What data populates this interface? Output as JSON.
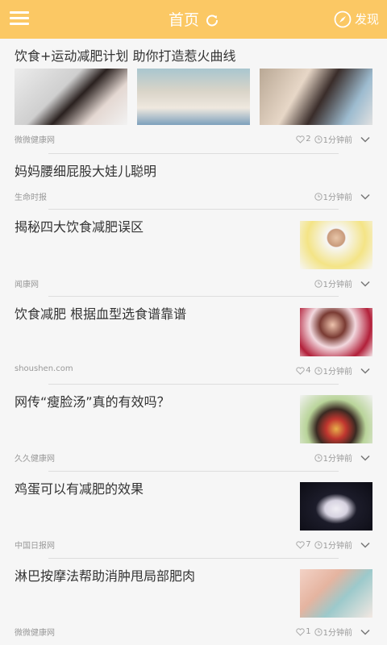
{
  "header": {
    "title": "首页",
    "discover_label": "发现"
  },
  "feed": [
    {
      "title": "饮食+运动减肥计划 助你打造惹火曲线",
      "source": "微微健康网",
      "likes": "2",
      "time": "1分钟前",
      "images": [
        "woman-black-dress-photo",
        "woman-smiling-photo",
        "woman-street-photo"
      ]
    },
    {
      "title": "妈妈腰细屁股大娃儿聪明",
      "source": "生命时报",
      "time": "1分钟前"
    },
    {
      "title": "揭秘四大饮食减肥误区",
      "source": "闻康网",
      "time": "1分钟前",
      "image": "woman-yellow-top-photo"
    },
    {
      "title": "饮食减肥 根据血型选食谱靠谱",
      "source": "shoushen.com",
      "likes": "4",
      "time": "1分钟前",
      "image": "woman-red-jacket-photo"
    },
    {
      "title": "网传“瘦脸汤”真的有效吗？",
      "source": "久久健康网",
      "time": "1分钟前",
      "image": "soup-bowl-photo"
    },
    {
      "title": "鸡蛋可以有减肥的效果",
      "source": "中国日报网",
      "likes": "7",
      "time": "1分钟前",
      "image": "egg-photo"
    },
    {
      "title": "淋巴按摩法帮助消肿甩局部肥肉",
      "source": "微微健康网",
      "likes": "1",
      "time": "1分钟前",
      "image": "spa-massage-photo"
    }
  ]
}
